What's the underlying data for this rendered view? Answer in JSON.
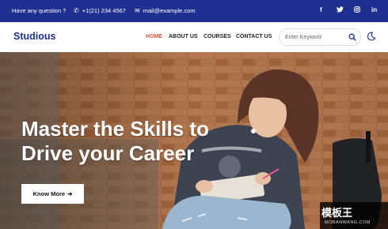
{
  "topbar": {
    "question": "Have any question ?",
    "phone": "+1(21) 234 4567",
    "email": "mail@example.com",
    "social": [
      "f",
      "t",
      "ig",
      "in"
    ]
  },
  "nav": {
    "logo": "Studious",
    "links": [
      "HOME",
      "ABOUT US",
      "COURSES",
      "CONTACT US"
    ],
    "active_link": "HOME",
    "search_placeholder": "Enter Keyword"
  },
  "hero": {
    "title_line1": "Master the Skills to",
    "title_line2": "Drive your Career",
    "cta_label": "Know More"
  },
  "watermark": {
    "logo": "模板王",
    "site": "MOBANWANG.COM"
  },
  "colors": {
    "brand": "#1f2f8f",
    "accent": "#e0553c"
  },
  "icons": {
    "phone": "phone-icon",
    "mail": "mail-icon",
    "search": "search-icon",
    "theme": "moon-icon",
    "cta_arrow": "arrow-right-icon"
  }
}
